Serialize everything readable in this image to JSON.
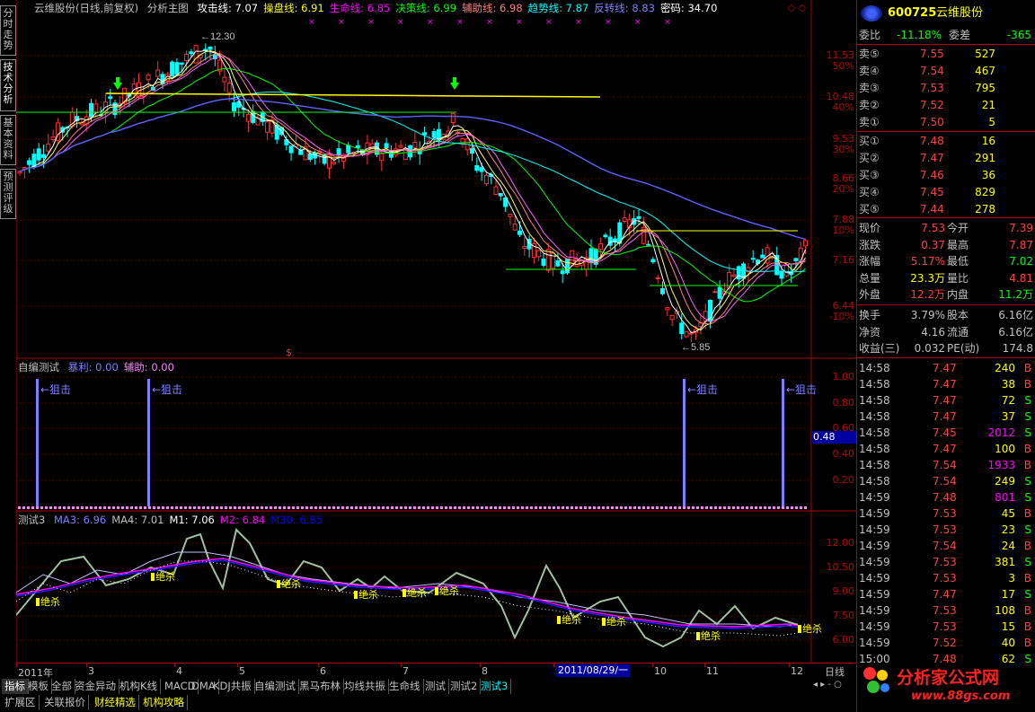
{
  "main_title": {
    "name": "云维股份(日线,前复权)",
    "chart": "分析主图",
    "items": [
      {
        "label": "攻击线: 7.07",
        "color": "#ffffff"
      },
      {
        "label": "操盘线: 6.91",
        "color": "#ffff00"
      },
      {
        "label": "生命线: 6.85",
        "color": "#ff00ff"
      },
      {
        "label": "决策线: 6.99",
        "color": "#00ff00"
      },
      {
        "label": "辅助线: 6.98",
        "color": "#ff8080"
      },
      {
        "label": "趋势线: 7.87",
        "color": "#00ffff"
      },
      {
        "label": "反转线: 8.83",
        "color": "#8080ff"
      },
      {
        "label": "密码: 34.70",
        "color": "#ffffff"
      }
    ]
  },
  "side_tabs": [
    "分时走势",
    "技术分析",
    "基本资料",
    "预测评级"
  ],
  "price_axis": [
    {
      "price": "11.53",
      "pct": "50%"
    },
    {
      "price": "10.48",
      "pct": "40%"
    },
    {
      "price": "9.53",
      "pct": "30%"
    },
    {
      "price": "8.66",
      "pct": "20%"
    },
    {
      "price": "7.88",
      "pct": "10%"
    },
    {
      "price": "7.16",
      "pct": ""
    },
    {
      "price": "6.44",
      "pct": "-10%"
    }
  ],
  "price_marks": {
    "high": "12.30",
    "low": "5.85"
  },
  "ind1": {
    "title": "自编测试",
    "items": [
      {
        "label": "暴利: 0.00",
        "color": "#8080ff"
      },
      {
        "label": "辅助: 0.00",
        "color": "#ff80ff"
      }
    ],
    "axis": [
      "1.00",
      "0.80",
      "0.60",
      "0.40",
      "0.20"
    ],
    "cursor_value": "0.48",
    "signal_label": "←狙击"
  },
  "ind2": {
    "title": "测试3",
    "items": [
      {
        "label": "MA3: 6.96",
        "color": "#8080ff"
      },
      {
        "label": "MA4: 7.01",
        "color": "#c0c0c0"
      },
      {
        "label": "M1: 7.06",
        "color": "#ffffff"
      },
      {
        "label": "M2: 6.84",
        "color": "#ff00ff"
      },
      {
        "label": "M30: 6.85",
        "color": "#0000ff"
      }
    ],
    "axis": [
      "12.00",
      "10.50",
      "9.00",
      "7.50",
      "6.00"
    ],
    "signal_label": "绝杀"
  },
  "x_axis": {
    "labels": [
      "2011年",
      "3",
      "4",
      "5",
      "6",
      "7",
      "8",
      "9",
      "10",
      "11",
      "12"
    ],
    "cursor_date": "2011/08/29/一",
    "period": "日线"
  },
  "bottom_tabs": [
    "指标",
    "模板",
    "全部",
    "资金异动",
    "机构K线",
    "MACD",
    "DMA",
    "KDJ共振",
    "自编测试",
    "黑马布林",
    "均线共振",
    "生命线",
    "测试",
    "测试2",
    "测试3"
  ],
  "bottom_tabs2": [
    "扩展区",
    "关联报价",
    "财经精选",
    "机构攻略"
  ],
  "stock": {
    "code": "600725",
    "name": "云维股份"
  },
  "weibi": {
    "label1": "委比",
    "val1": "-11.18%",
    "label2": "委差",
    "val2": "-365"
  },
  "asks": [
    {
      "label": "卖⑤",
      "price": "7.55",
      "vol": "527"
    },
    {
      "label": "卖④",
      "price": "7.54",
      "vol": "467"
    },
    {
      "label": "卖③",
      "price": "7.53",
      "vol": "795"
    },
    {
      "label": "卖②",
      "price": "7.52",
      "vol": "21"
    },
    {
      "label": "卖①",
      "price": "7.50",
      "vol": "5"
    }
  ],
  "bids": [
    {
      "label": "买①",
      "price": "7.48",
      "vol": "16"
    },
    {
      "label": "买②",
      "price": "7.47",
      "vol": "291"
    },
    {
      "label": "买③",
      "price": "7.46",
      "vol": "36"
    },
    {
      "label": "买④",
      "price": "7.45",
      "vol": "829"
    },
    {
      "label": "买⑤",
      "price": "7.44",
      "vol": "278"
    }
  ],
  "stats": [
    {
      "l1": "现价",
      "v1": "7.53",
      "c1": "#ff4040",
      "l2": "今开",
      "v2": "7.39",
      "c2": "#ff4040"
    },
    {
      "l1": "涨跌",
      "v1": "0.37",
      "c1": "#ff4040",
      "l2": "最高",
      "v2": "7.87",
      "c2": "#ff4040"
    },
    {
      "l1": "涨幅",
      "v1": "5.17%",
      "c1": "#ff4040",
      "l2": "最低",
      "v2": "7.02",
      "c2": "#00ff00"
    },
    {
      "l1": "总量",
      "v1": "23.3万",
      "c1": "#ffff00",
      "l2": "量比",
      "v2": "4.81",
      "c2": "#ff4040"
    },
    {
      "l1": "外盘",
      "v1": "12.2万",
      "c1": "#ff4040",
      "l2": "内盘",
      "v2": "11.2万",
      "c2": "#00ff00"
    }
  ],
  "stats2": [
    {
      "l1": "换手",
      "v1": "3.79%",
      "l2": "股本",
      "v2": "6.16亿"
    },
    {
      "l1": "净资",
      "v1": "4.16",
      "l2": "流通",
      "v2": "6.16亿"
    },
    {
      "l1": "收益(三)",
      "v1": "0.032",
      "l2": "PE(动)",
      "v2": "174.8"
    }
  ],
  "ticks": [
    {
      "t": "14:58",
      "p": "7.47",
      "v": "240",
      "d": "B"
    },
    {
      "t": "14:58",
      "p": "7.47",
      "v": "38",
      "d": "B"
    },
    {
      "t": "14:58",
      "p": "7.47",
      "v": "72",
      "d": "S"
    },
    {
      "t": "14:58",
      "p": "7.47",
      "v": "37",
      "d": "S"
    },
    {
      "t": "14:58",
      "p": "7.45",
      "v": "2012",
      "d": "S"
    },
    {
      "t": "14:58",
      "p": "7.47",
      "v": "100",
      "d": "B"
    },
    {
      "t": "14:58",
      "p": "7.54",
      "v": "1933",
      "d": "B"
    },
    {
      "t": "14:58",
      "p": "7.54",
      "v": "249",
      "d": "S"
    },
    {
      "t": "14:59",
      "p": "7.48",
      "v": "801",
      "d": "S"
    },
    {
      "t": "14:59",
      "p": "7.53",
      "v": "45",
      "d": "B"
    },
    {
      "t": "14:59",
      "p": "7.53",
      "v": "23",
      "d": "S"
    },
    {
      "t": "14:59",
      "p": "7.54",
      "v": "24",
      "d": "B"
    },
    {
      "t": "14:59",
      "p": "7.53",
      "v": "381",
      "d": "S"
    },
    {
      "t": "14:59",
      "p": "7.53",
      "v": "3",
      "d": "B"
    },
    {
      "t": "14:59",
      "p": "7.47",
      "v": "17",
      "d": "S"
    },
    {
      "t": "14:59",
      "p": "7.53",
      "v": "108",
      "d": "B"
    },
    {
      "t": "14:59",
      "p": "7.53",
      "v": "15",
      "d": "B"
    },
    {
      "t": "14:59",
      "p": "7.52",
      "v": "40",
      "d": "B"
    },
    {
      "t": "15:00",
      "p": "7.48",
      "v": "62",
      "d": "S"
    }
  ],
  "watermark": {
    "name": "分析家公式网",
    "url": "www.88gs.com"
  },
  "colors": {
    "grid": "#b00000",
    "up": "#ff3030",
    "down": "#00ffff",
    "text": "#c0c0c0"
  }
}
